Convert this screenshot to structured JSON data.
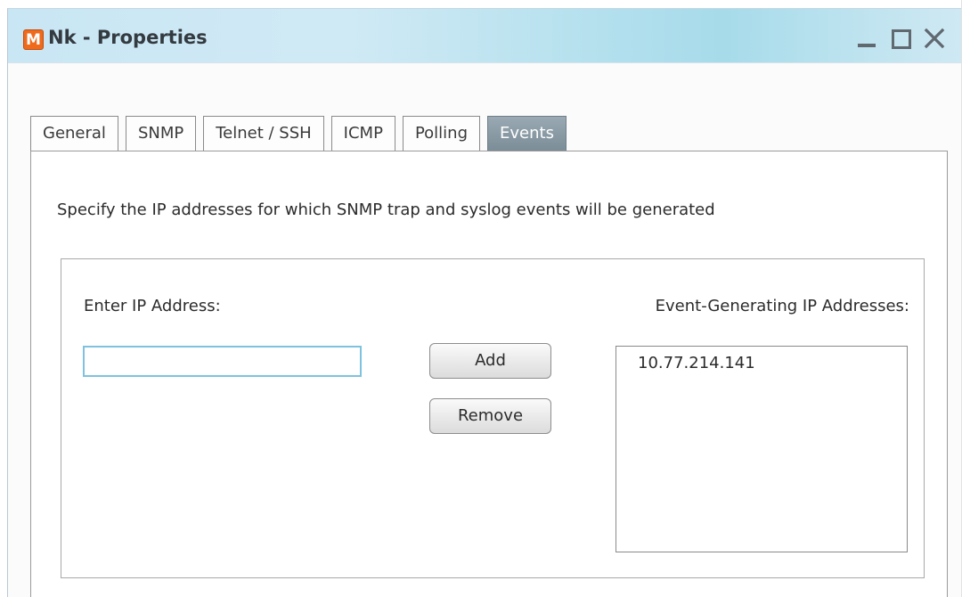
{
  "window": {
    "app_logo": "M",
    "title": "Nk - Properties",
    "controls": {
      "minimize_icon": "minimize-icon",
      "maximize_icon": "maximize-icon",
      "close_icon": "close-icon"
    }
  },
  "tabs": [
    {
      "label": "General",
      "active": false
    },
    {
      "label": "SNMP",
      "active": false
    },
    {
      "label": "Telnet / SSH",
      "active": false
    },
    {
      "label": "ICMP",
      "active": false
    },
    {
      "label": "Polling",
      "active": false
    },
    {
      "label": "Events",
      "active": true
    }
  ],
  "events": {
    "description": "Specify the IP addresses for which SNMP trap and syslog events will be generated",
    "ip_label": "Enter IP Address:",
    "ip_value": "",
    "list_label": "Event-Generating IP Addresses:",
    "add_label": "Add",
    "remove_label": "Remove",
    "addresses": [
      "10.77.214.141"
    ]
  },
  "colors": {
    "logo": "#f06a1c",
    "active_tab": "#8a9aa4",
    "input_focus": "#7ec2df"
  }
}
